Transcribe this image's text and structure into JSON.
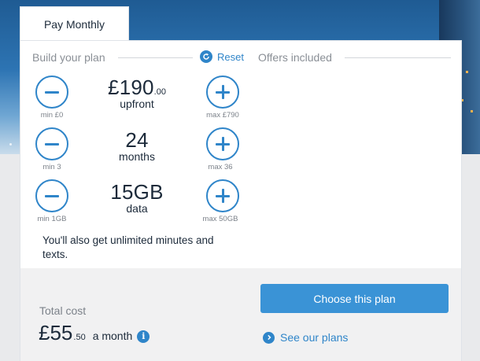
{
  "tab": {
    "label": "Pay Monthly"
  },
  "build": {
    "title": "Build your plan",
    "reset_label": "Reset",
    "controls": [
      {
        "value_main": "£190",
        "value_decimal": ".00",
        "unit": "upfront",
        "min": "min £0",
        "max": "max £790"
      },
      {
        "value_main": "24",
        "value_decimal": "",
        "unit": "months",
        "min": "min 3",
        "max": "max 36"
      },
      {
        "value_main": "15GB",
        "value_decimal": "",
        "unit": "data",
        "min": "min 1GB",
        "max": "max 50GB"
      }
    ],
    "note": "You'll also get unlimited minutes and texts."
  },
  "offers": {
    "title": "Offers included"
  },
  "summary": {
    "total_label": "Total cost",
    "price_main": "£55",
    "price_decimal": ".50",
    "price_period": "a month",
    "info_glyph": "i",
    "choose_label": "Choose this plan",
    "see_plans_label": "See our plans"
  },
  "colors": {
    "accent": "#2f85c9",
    "button": "#3a93d6",
    "text": "#1c2a3a",
    "muted": "#7c828a"
  }
}
